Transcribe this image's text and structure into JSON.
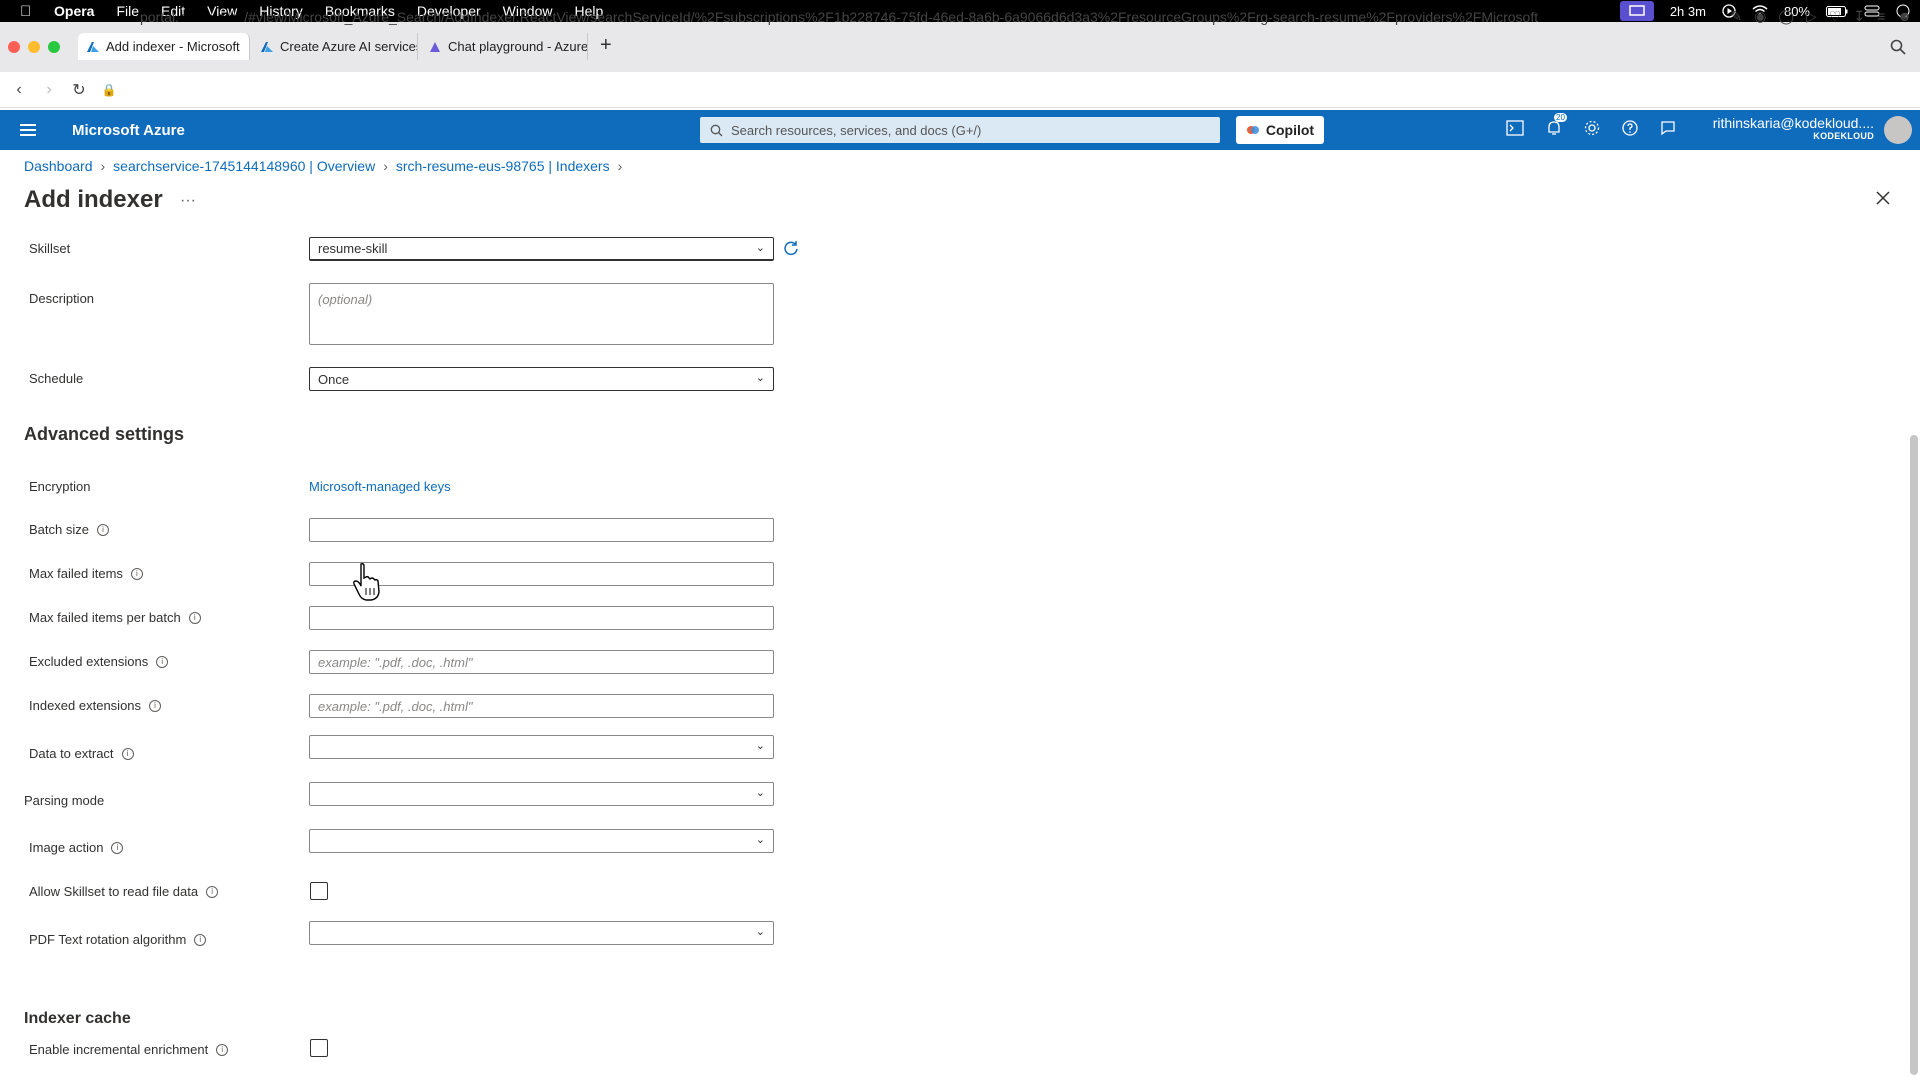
{
  "macos_menubar": {
    "app": "Opera",
    "items": [
      "File",
      "Edit",
      "View",
      "History",
      "Bookmarks",
      "Developer",
      "Window",
      "Help"
    ],
    "time_remaining": "2h 3m",
    "battery": "80%"
  },
  "browser": {
    "tabs": [
      {
        "label": "Add indexer - Microsoft",
        "active": true
      },
      {
        "label": "Create Azure AI services",
        "active": false
      },
      {
        "label": "Chat playground - Azure",
        "active": false
      }
    ],
    "url_prefix": "portal.",
    "url_domain": "azure.com",
    "url_rest": "/#view/Microsoft_Azure_Search/AddIndexer.ReactView/searchServiceId/%2Fsubscriptions%2F1b228746-75fd-46ed-8a6b-6a9066d6d3a3%2FresourceGroups%2Frg-search-resume%2Fproviders%2FMicrosoft"
  },
  "azure_header": {
    "brand": "Microsoft Azure",
    "search_placeholder": "Search resources, services, and docs (G+/)",
    "copilot_label": "Copilot",
    "notification_count": "20",
    "account_email": "rithinskaria@kodekloud....",
    "account_org": "KODEKLOUD"
  },
  "breadcrumb": {
    "items": [
      "Dashboard",
      "searchservice-1745144148960 | Overview",
      "srch-resume-eus-98765 | Indexers"
    ]
  },
  "page": {
    "title": "Add indexer",
    "ellipsis": "···"
  },
  "form": {
    "skillset": {
      "label": "Skillset",
      "value": "resume-skill"
    },
    "description": {
      "label": "Description",
      "placeholder": "(optional)"
    },
    "schedule": {
      "label": "Schedule",
      "value": "Once"
    },
    "advanced_title": "Advanced settings",
    "encryption": {
      "label": "Encryption",
      "value": "Microsoft-managed keys"
    },
    "batch_size": {
      "label": "Batch size",
      "value": ""
    },
    "max_failed_items": {
      "label": "Max failed items",
      "value": ""
    },
    "max_failed_per_batch": {
      "label": "Max failed items per batch",
      "value": ""
    },
    "excluded_extensions": {
      "label": "Excluded extensions",
      "placeholder": "example: \".pdf, .doc, .html\""
    },
    "indexed_extensions": {
      "label": "Indexed extensions",
      "placeholder": "example: \".pdf, .doc, .html\""
    },
    "data_to_extract": {
      "label": "Data to extract",
      "value": ""
    },
    "parsing_mode": {
      "label": "Parsing mode",
      "value": ""
    },
    "image_action": {
      "label": "Image action",
      "value": ""
    },
    "allow_skillset_read": {
      "label": "Allow Skillset to read file data",
      "checked": false
    },
    "pdf_rotation": {
      "label": "PDF Text rotation algorithm",
      "value": ""
    },
    "cache_title": "Indexer cache",
    "incremental_enrichment": {
      "label": "Enable incremental enrichment",
      "checked": false
    }
  }
}
